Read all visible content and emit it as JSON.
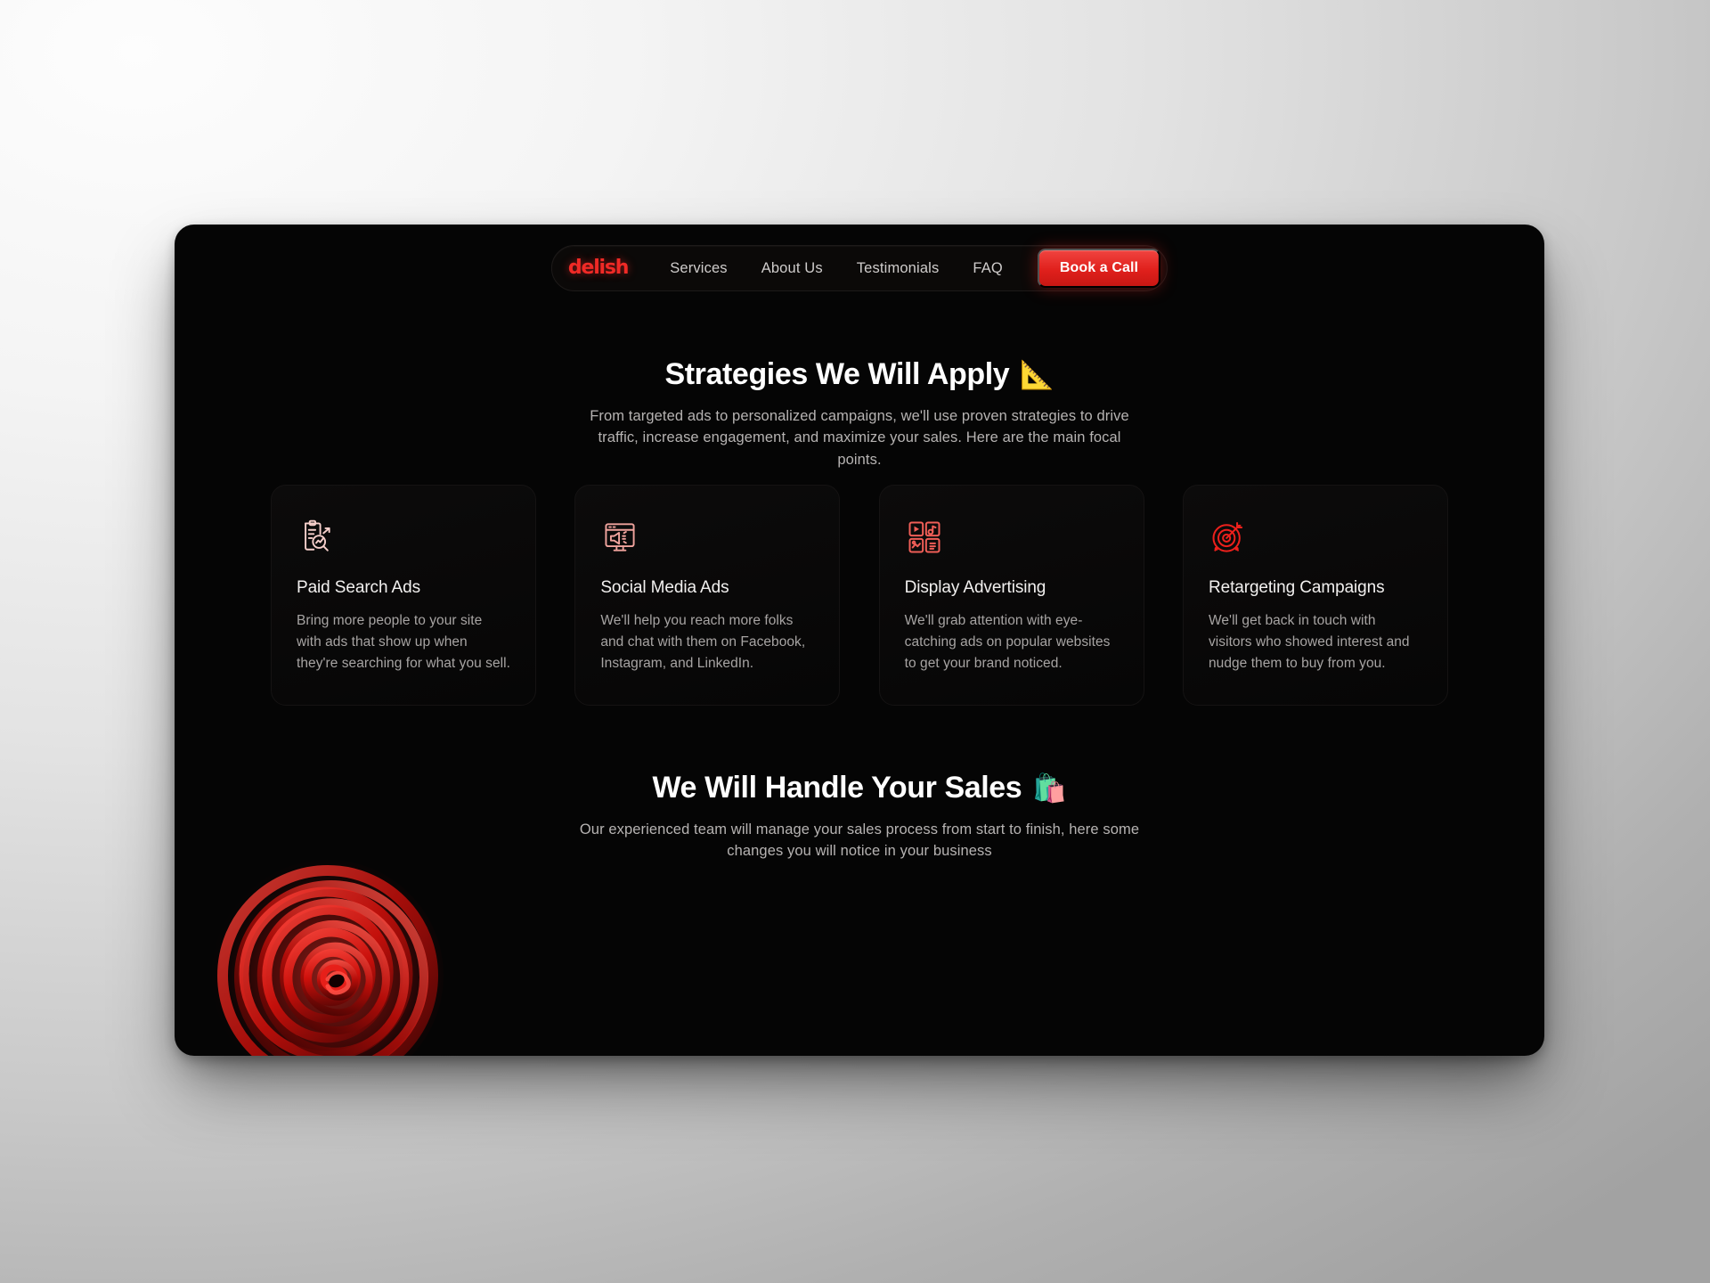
{
  "brand": {
    "logo_text": "delish",
    "accent": "#ef2a26"
  },
  "nav": {
    "links": [
      {
        "label": "Services"
      },
      {
        "label": "About Us"
      },
      {
        "label": "Testimonials"
      },
      {
        "label": "FAQ"
      }
    ],
    "cta_label": "Book a Call"
  },
  "strategies": {
    "title": "Strategies We Will Apply",
    "title_emoji": "📐",
    "subtitle": "From targeted ads to personalized campaigns, we'll use proven strategies to drive traffic, increase engagement, and maximize your sales. Here are the main focal points.",
    "cards": [
      {
        "icon": "clipboard-search-chart-icon",
        "icon_color": "#f6cfcb",
        "title": "Paid Search Ads",
        "desc": "Bring more people to your site with ads that show up when they're searching for what you sell."
      },
      {
        "icon": "monitor-megaphone-icon",
        "icon_color": "#f0a39d",
        "title": "Social Media Ads",
        "desc": "We'll help you reach more folks and chat with them on Facebook, Instagram, and LinkedIn."
      },
      {
        "icon": "media-grid-icon",
        "icon_color": "#ef5e57",
        "title": "Display Advertising",
        "desc": "We'll grab attention with eye-catching ads on popular websites to get your brand noticed."
      },
      {
        "icon": "target-arrow-icon",
        "icon_color": "#ed201c",
        "title": "Retargeting Campaigns",
        "desc": "We'll get back in touch with visitors who showed interest and nudge them to buy from you."
      }
    ]
  },
  "sales": {
    "title": "We Will Handle Your Sales",
    "title_emoji": "🛍️",
    "subtitle": "Our experienced team will manage your sales process from start to finish, here some changes you will notice in your business"
  },
  "decor": {
    "rose": "red-rose-spiral-graphic"
  }
}
